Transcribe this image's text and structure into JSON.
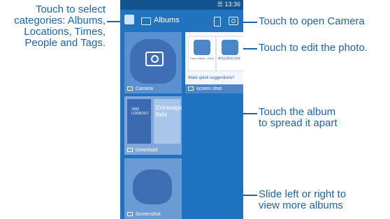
{
  "callouts": {
    "select_categories": [
      "Touch to select",
      "categories: Albums,",
      "Locations, Times,",
      "People and Tags."
    ],
    "open_camera": "Touch to open Camera",
    "edit_photo": "Touch to edit the photo.",
    "spread_album": [
      "Touch the album",
      "to spread it apart"
    ],
    "slide_albums": [
      "Slide left or right to",
      "view more albums"
    ]
  },
  "phone": {
    "status_time": "13:36",
    "appbar_title": "Albums",
    "albums": {
      "camera": "Camera",
      "screen_shot": "screen shot",
      "download": "Download",
      "screenshot": "Screenshot"
    },
    "shot_cards": {
      "card1": "Farm Mania - Farm",
      "card2": "都是运营测试游戏",
      "suggestion": "Want quick suggestions?"
    },
    "download_text": {
      "left": [
        "1993",
        "LOOKOUT"
      ],
      "right": [
        "Extravagan",
        "Behi"
      ]
    }
  },
  "colors": {
    "callout_blue": "#1a63ad",
    "screen_blue": "#1f72c0"
  }
}
